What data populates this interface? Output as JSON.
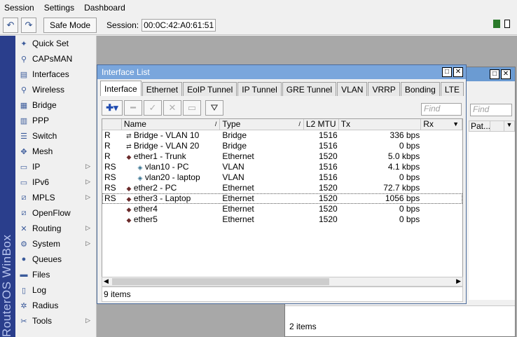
{
  "menubar": {
    "items": [
      "Session",
      "Settings",
      "Dashboard"
    ]
  },
  "toolbar": {
    "undo_icon": "undo-icon",
    "redo_icon": "redo-icon",
    "safe_mode_label": "Safe Mode",
    "session_label": "Session:",
    "session_value": "00:0C:42:A0:61:51"
  },
  "sidebar": {
    "brand": "RouterOS WinBox",
    "items": [
      {
        "label": "Quick Set",
        "icon": "wand-icon",
        "submenu": false
      },
      {
        "label": "CAPsMAN",
        "icon": "antenna-icon",
        "submenu": false
      },
      {
        "label": "Interfaces",
        "icon": "interfaces-icon",
        "submenu": false
      },
      {
        "label": "Wireless",
        "icon": "wireless-icon",
        "submenu": false
      },
      {
        "label": "Bridge",
        "icon": "bridge-icon",
        "submenu": false
      },
      {
        "label": "PPP",
        "icon": "ppp-icon",
        "submenu": false
      },
      {
        "label": "Switch",
        "icon": "switch-icon",
        "submenu": false
      },
      {
        "label": "Mesh",
        "icon": "mesh-icon",
        "submenu": false
      },
      {
        "label": "IP",
        "icon": "ip-icon",
        "submenu": true
      },
      {
        "label": "IPv6",
        "icon": "ipv6-icon",
        "submenu": true
      },
      {
        "label": "MPLS",
        "icon": "mpls-icon",
        "submenu": true
      },
      {
        "label": "OpenFlow",
        "icon": "openflow-icon",
        "submenu": false
      },
      {
        "label": "Routing",
        "icon": "routing-icon",
        "submenu": true
      },
      {
        "label": "System",
        "icon": "gear-icon",
        "submenu": true
      },
      {
        "label": "Queues",
        "icon": "queues-icon",
        "submenu": false
      },
      {
        "label": "Files",
        "icon": "folder-icon",
        "submenu": false
      },
      {
        "label": "Log",
        "icon": "log-icon",
        "submenu": false
      },
      {
        "label": "Radius",
        "icon": "radius-icon",
        "submenu": false
      },
      {
        "label": "Tools",
        "icon": "tools-icon",
        "submenu": true
      }
    ]
  },
  "bg_window": {
    "find_placeholder": "Find",
    "col_partial": "Pat...",
    "status": "2 items"
  },
  "window": {
    "title": "Interface List",
    "tabs": [
      "Interface",
      "Ethernet",
      "EoIP Tunnel",
      "IP Tunnel",
      "GRE Tunnel",
      "VLAN",
      "VRRP",
      "Bonding",
      "LTE"
    ],
    "active_tab": "Interface",
    "find_placeholder": "Find",
    "columns": {
      "name": "Name",
      "type": "Type",
      "mtu": "L2 MTU",
      "tx": "Tx",
      "rx": "Rx"
    },
    "rows": [
      {
        "flag": "R",
        "name": "Bridge - VLAN 10",
        "type": "Bridge",
        "mtu": "1516",
        "tx": "336 bps",
        "icon": "bridge",
        "indent": false
      },
      {
        "flag": "R",
        "name": "Bridge - VLAN 20",
        "type": "Bridge",
        "mtu": "1516",
        "tx": "0 bps",
        "icon": "bridge",
        "indent": false
      },
      {
        "flag": "R",
        "name": "ether1 - Trunk",
        "type": "Ethernet",
        "mtu": "1520",
        "tx": "5.0 kbps",
        "icon": "eth",
        "indent": false
      },
      {
        "flag": "RS",
        "name": "vlan10 - PC",
        "type": "VLAN",
        "mtu": "1516",
        "tx": "4.1 kbps",
        "icon": "vlan",
        "indent": true
      },
      {
        "flag": "RS",
        "name": "vlan20 - laptop",
        "type": "VLAN",
        "mtu": "1516",
        "tx": "0 bps",
        "icon": "vlan",
        "indent": true
      },
      {
        "flag": "RS",
        "name": "ether2 - PC",
        "type": "Ethernet",
        "mtu": "1520",
        "tx": "72.7 kbps",
        "icon": "eth",
        "indent": false
      },
      {
        "flag": "RS",
        "name": "ether3 - Laptop",
        "type": "Ethernet",
        "mtu": "1520",
        "tx": "1056 bps",
        "icon": "eth",
        "indent": false
      },
      {
        "flag": "",
        "name": "ether4",
        "type": "Ethernet",
        "mtu": "1520",
        "tx": "0 bps",
        "icon": "eth",
        "indent": false
      },
      {
        "flag": "",
        "name": "ether5",
        "type": "Ethernet",
        "mtu": "1520",
        "tx": "0 bps",
        "icon": "eth",
        "indent": false
      }
    ],
    "status": "9 items"
  }
}
